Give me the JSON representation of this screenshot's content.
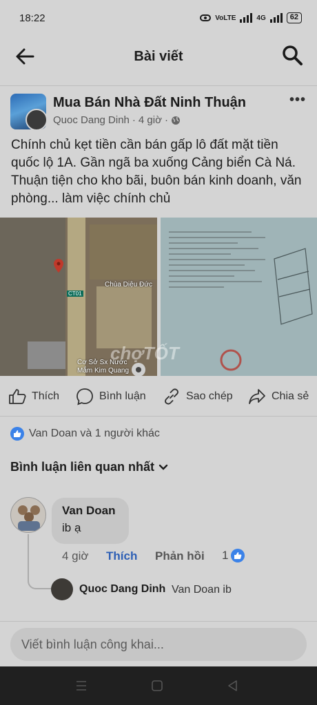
{
  "status": {
    "time": "18:22",
    "network": "VoLTE",
    "mobile": "4G",
    "battery": "62"
  },
  "header": {
    "title": "Bài viết",
    "back_icon": "arrow-left-icon",
    "search_icon": "search-icon"
  },
  "post": {
    "group": "Mua Bán Nhà Đất Ninh Thuận",
    "author": "Quoc Dang Dinh",
    "time": "4 giờ",
    "text": "Chính chủ kẹt tiền cần bán gấp lô đất mặt tiền quốc lộ 1A. Gần ngã ba xuống Cảng biển Cà Ná. Thuận tiện cho kho bãi, buôn bán kinh doanh, văn phòng... làm việc chính chủ",
    "map_labels": [
      "Chùa Diệu Đức",
      "CT01",
      "Cơ Sở Sx Nước",
      "Mắm Kim Quang"
    ],
    "watermark": "chợTỐT"
  },
  "actions": {
    "like": "Thích",
    "comment": "Bình luận",
    "copy": "Sao chép",
    "share": "Chia sẻ"
  },
  "reactions": {
    "text": "Van Doan và 1 người khác"
  },
  "comments": {
    "sort_label": "Bình luận liên quan nhất",
    "items": [
      {
        "name": "Van Doan",
        "text": "ib ạ",
        "time": "4 giờ",
        "like": "Thích",
        "reply": "Phản hồi",
        "like_count": "1"
      }
    ],
    "reply": {
      "name": "Quoc Dang Dinh",
      "text": "Van Doan ib"
    }
  },
  "composer": {
    "placeholder": "Viết bình luận công khai..."
  }
}
